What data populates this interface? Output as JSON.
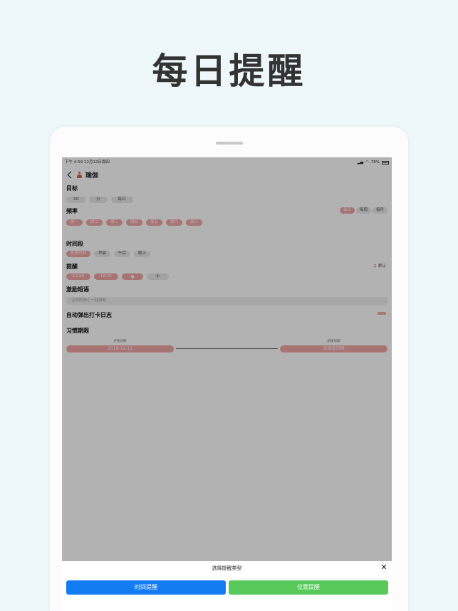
{
  "headline": "每日提醒",
  "status": {
    "left": "下午 4:59   12月12日周四",
    "battery": "78%"
  },
  "nav": {
    "title": "瑜伽"
  },
  "goal": {
    "label": "目标",
    "amount": "30",
    "unit": "分",
    "period": "每日"
  },
  "frequency": {
    "label": "频率",
    "modes": [
      "每日",
      "每周",
      "每月"
    ],
    "days": [
      "周一",
      "周二",
      "周三",
      "周四",
      "周五",
      "周六",
      "周日"
    ]
  },
  "timeslot": {
    "label": "时间段",
    "options": [
      "任意时间",
      "早晨",
      "午后",
      "晚上"
    ]
  },
  "reminder": {
    "label": "提醒",
    "default_label": "默认",
    "times": [
      "16:58",
      "19:30"
    ]
  },
  "motto": {
    "label": "激励短语",
    "placeholder": "让你的身心一起放松"
  },
  "auto_popup": {
    "label": "自动弹出打卡日志"
  },
  "period": {
    "label": "习惯期限",
    "start_label": "开始日期",
    "start_value": "2019-12-12",
    "end_label": "结束日期",
    "end_value": "无结束日期"
  },
  "sheet": {
    "title": "选择提醒类型",
    "time_button": "时间提醒",
    "location_button": "位置提醒"
  },
  "colors": {
    "accent": "#f1a5a5",
    "blue": "#147cf3",
    "green": "#58c95a"
  }
}
